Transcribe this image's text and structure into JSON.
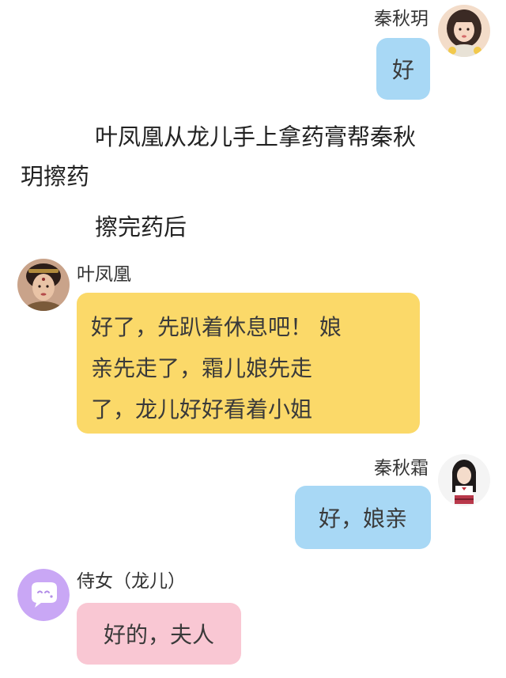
{
  "messages": [
    {
      "sender": "秦秋玥",
      "text": "好",
      "side": "right",
      "color": "#a8d8f5",
      "avatar_icon": "girl-avatar-icon"
    },
    {
      "sender": "叶凤凰",
      "text_lines": [
        "好了，先趴着休息吧！ 娘",
        "亲先走了，霜儿娘先走",
        "了，龙儿好好看着小姐"
      ],
      "side": "left",
      "color": "#fbd969",
      "avatar_icon": "woman-avatar-icon"
    },
    {
      "sender": "秦秋霜",
      "text": "好，娘亲",
      "side": "right",
      "color": "#a8d8f5",
      "avatar_icon": "schoolgirl-avatar-icon"
    },
    {
      "sender": "侍女（龙儿）",
      "text": "好的，夫人",
      "side": "left",
      "color": "#f9c7d3",
      "avatar_icon": "chat-bubble-avatar-icon"
    }
  ],
  "narration": {
    "line1": "叶凤凰从龙儿手上拿药膏帮秦秋",
    "line2": "玥擦药",
    "line3": "擦完药后"
  },
  "colors": {
    "bubble_blue": "#a8d8f5",
    "bubble_yellow": "#fbd969",
    "bubble_pink": "#f9c7d3",
    "avatar_purple": "#c9a7f5"
  }
}
